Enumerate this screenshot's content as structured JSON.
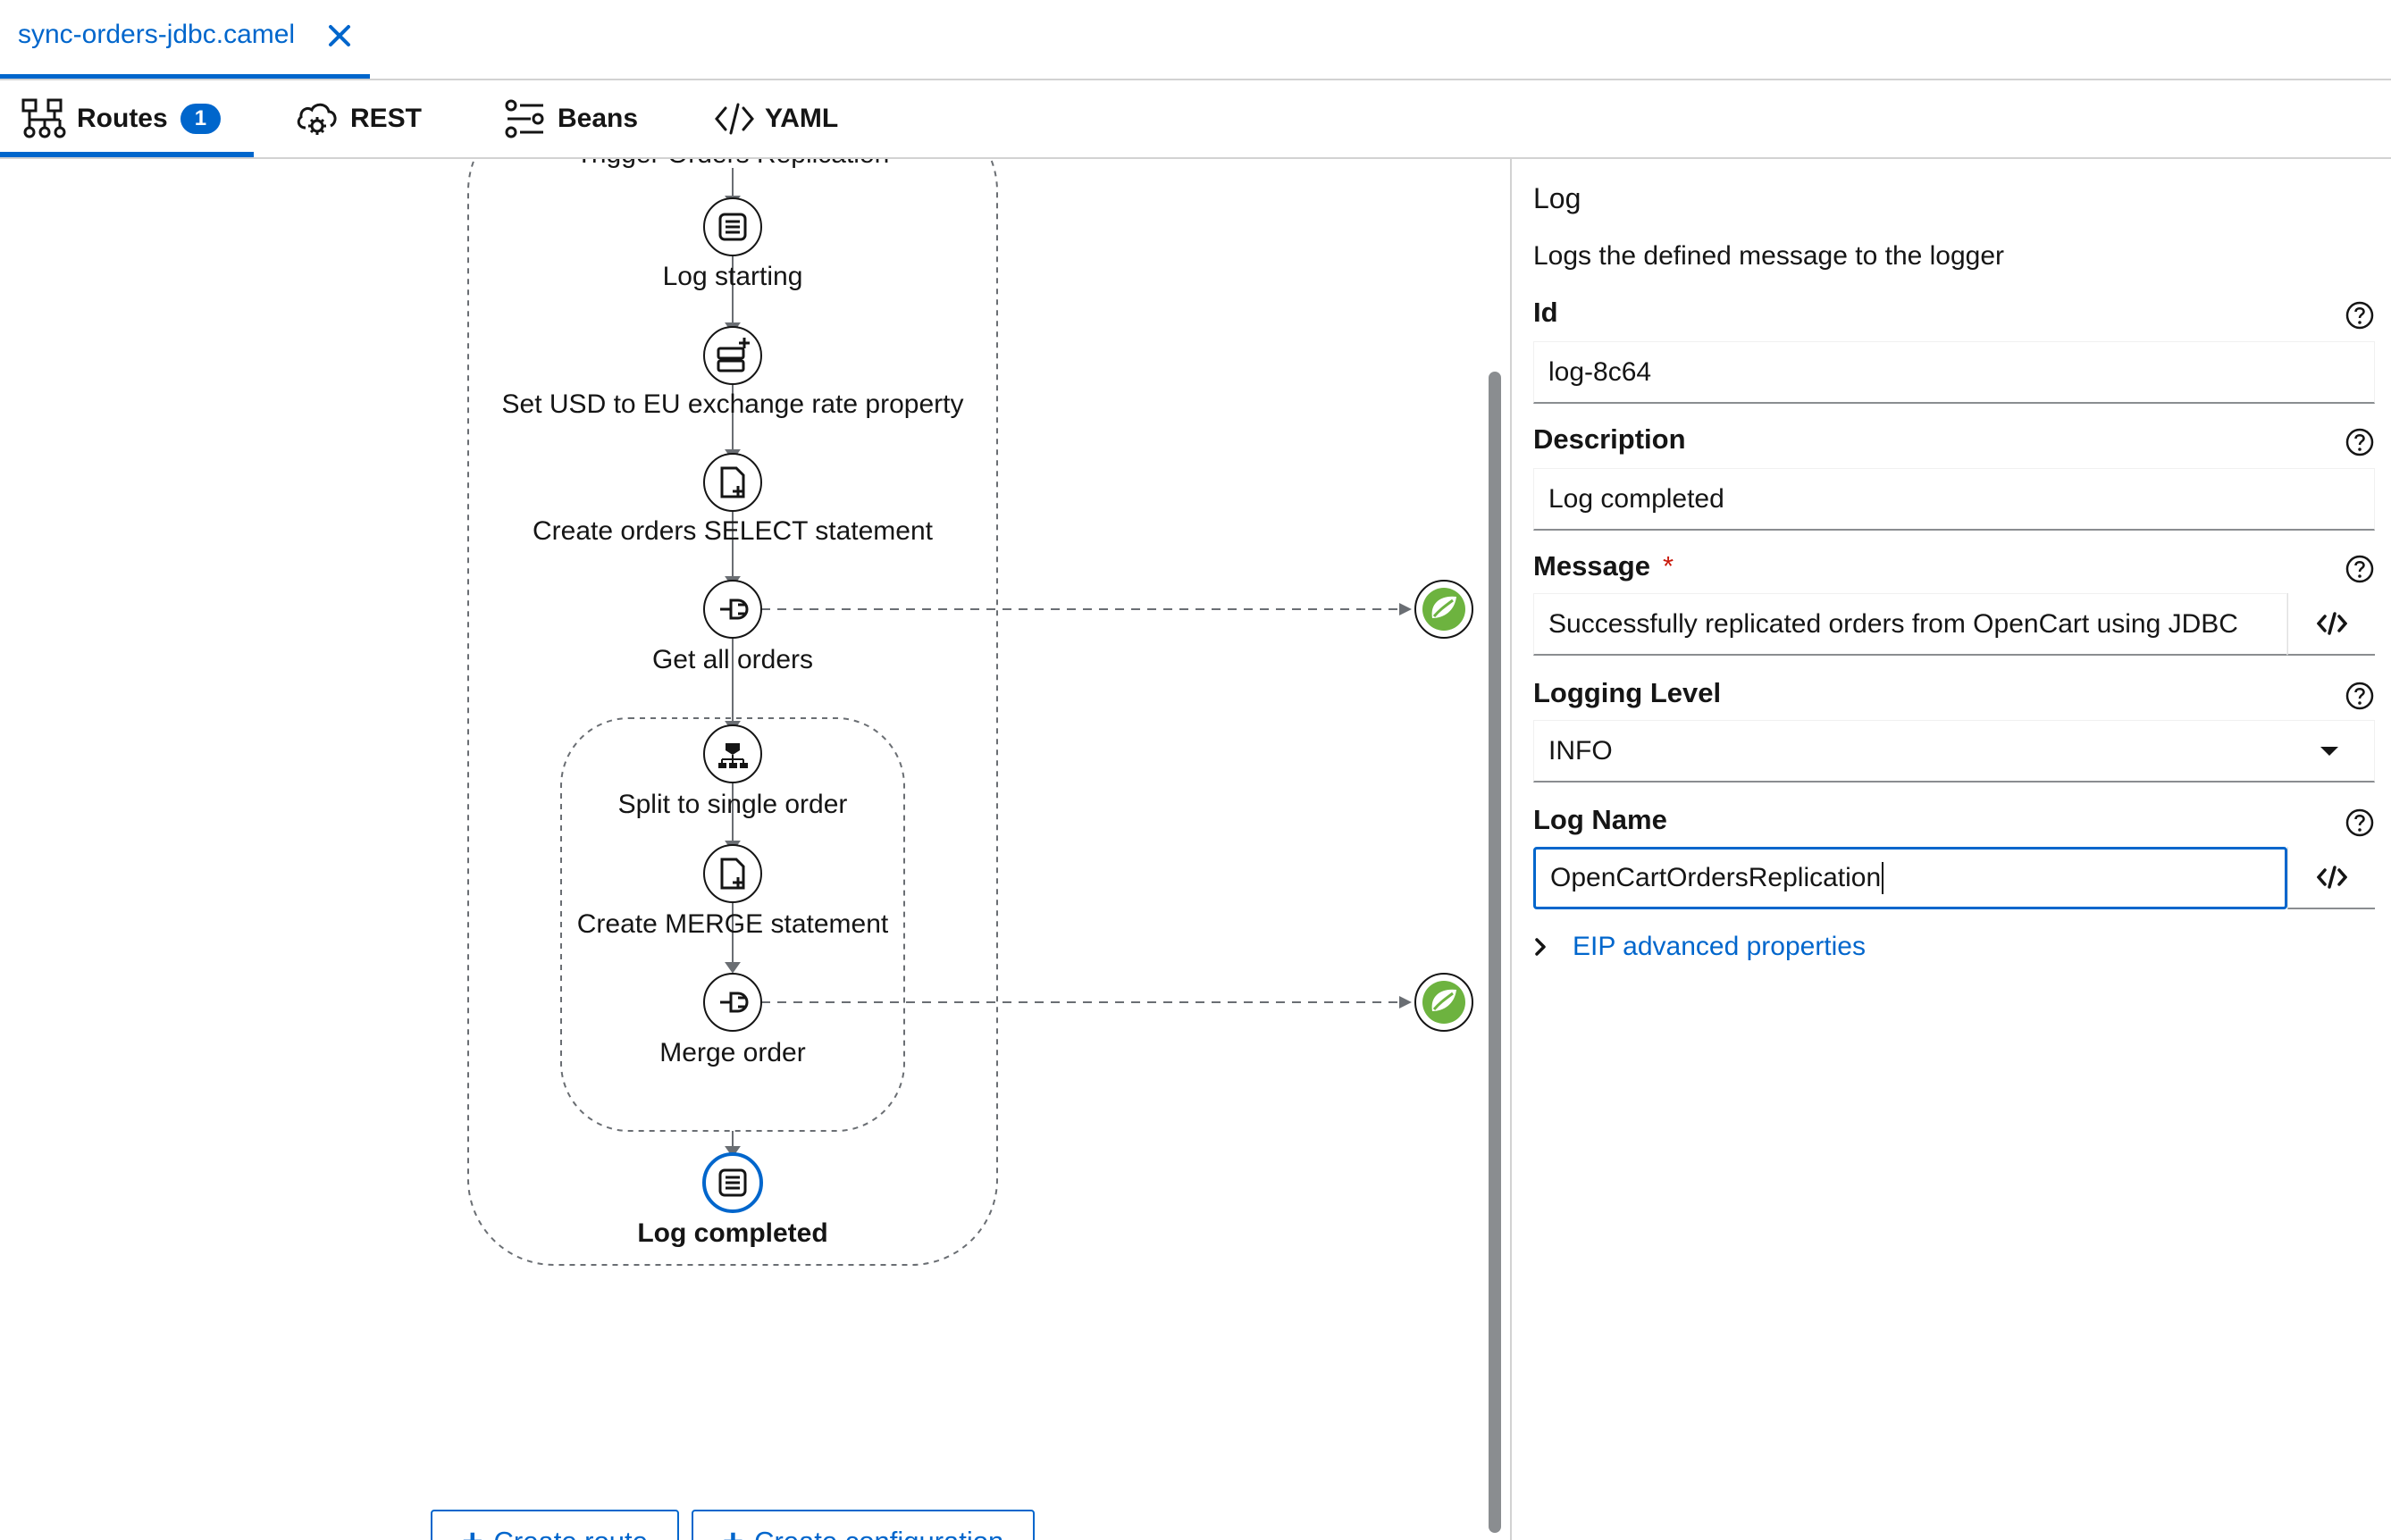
{
  "file_tab": {
    "name": "sync-orders-jdbc.camel"
  },
  "nav_tabs": {
    "routes": {
      "label": "Routes",
      "badge": "1"
    },
    "rest": {
      "label": "REST"
    },
    "beans": {
      "label": "Beans"
    },
    "yaml": {
      "label": "YAML"
    }
  },
  "diagram": {
    "partial_label": "Trigger Orders Replication",
    "nodes": [
      {
        "label": "Log starting",
        "icon": "log-icon"
      },
      {
        "label": "Set USD to EU exchange rate property",
        "icon": "set-property-icon"
      },
      {
        "label": "Create orders SELECT statement",
        "icon": "set-body-icon"
      },
      {
        "label": "Get all orders",
        "icon": "to-endpoint-icon"
      },
      {
        "label": "Split to single order",
        "icon": "split-icon"
      },
      {
        "label": "Create MERGE statement",
        "icon": "set-body-icon"
      },
      {
        "label": "Merge order",
        "icon": "to-endpoint-icon"
      },
      {
        "label": "Log completed",
        "icon": "log-icon",
        "selected": true
      }
    ],
    "endpoints": [
      "spring-jdbc-icon",
      "spring-jdbc-icon"
    ]
  },
  "canvas_buttons": {
    "create_route": "Create route",
    "create_configuration": "Create configuration"
  },
  "panel": {
    "title": "Log",
    "description": "Logs the defined message to the logger",
    "fields": {
      "id": {
        "label": "Id",
        "value": "log-8c64"
      },
      "description": {
        "label": "Description",
        "value": "Log completed"
      },
      "message": {
        "label": "Message",
        "required": "*",
        "value": "Successfully replicated orders from OpenCart using JDBC"
      },
      "logging_level": {
        "label": "Logging Level",
        "value": "INFO"
      },
      "log_name": {
        "label": "Log Name",
        "value": "OpenCartOrdersReplication"
      }
    },
    "advanced": {
      "label": "EIP advanced properties"
    }
  },
  "colors": {
    "accent": "#0066cc",
    "spring_green": "#6db33f",
    "required": "#c9190b"
  }
}
